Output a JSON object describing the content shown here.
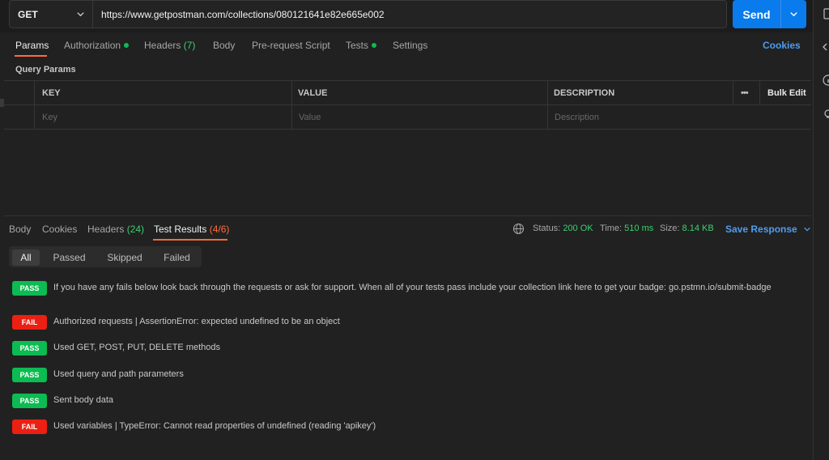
{
  "request": {
    "method": "GET",
    "url": "https://www.getpostman.com/collections/080121641e82e665e002",
    "send_label": "Send"
  },
  "request_tabs": [
    {
      "label": "Params",
      "count": "",
      "dot": false
    },
    {
      "label": "Authorization",
      "count": "",
      "dot": true
    },
    {
      "label": "Headers",
      "count": "(7)",
      "dot": false
    },
    {
      "label": "Body",
      "count": "",
      "dot": false
    },
    {
      "label": "Pre-request Script",
      "count": "",
      "dot": false
    },
    {
      "label": "Tests",
      "count": "",
      "dot": true
    },
    {
      "label": "Settings",
      "count": "",
      "dot": false
    }
  ],
  "cookies_label": "Cookies",
  "query_params": {
    "title": "Query Params",
    "headers": {
      "key": "KEY",
      "value": "VALUE",
      "description": "DESCRIPTION"
    },
    "bulk_edit": "Bulk Edit",
    "more_label": "•••",
    "placeholders": {
      "key": "Key",
      "value": "Value",
      "description": "Description"
    }
  },
  "response_tabs": [
    {
      "label": "Body",
      "count": ""
    },
    {
      "label": "Cookies",
      "count": ""
    },
    {
      "label": "Headers",
      "count": "(24)"
    },
    {
      "label": "Test Results",
      "count": "(4/6)"
    }
  ],
  "response_meta": {
    "status_label": "Status:",
    "status_value": "200 OK",
    "time_label": "Time:",
    "time_value": "510 ms",
    "size_label": "Size:",
    "size_value": "8.14 KB",
    "save_response": "Save Response"
  },
  "filters": [
    "All",
    "Passed",
    "Skipped",
    "Failed"
  ],
  "results": [
    {
      "status": "PASS",
      "text": "If you have any fails below look back through the requests or ask for support. When all of your tests pass include your collection link here to get your badge: go.pstmn.io/submit-badge"
    },
    {
      "status": "FAIL",
      "text": "Authorized requests | AssertionError: expected undefined to be an object"
    },
    {
      "status": "PASS",
      "text": "Used GET, POST, PUT, DELETE methods"
    },
    {
      "status": "PASS",
      "text": "Used query and path parameters"
    },
    {
      "status": "PASS",
      "text": "Sent body data"
    },
    {
      "status": "FAIL",
      "text": "Used variables | TypeError: Cannot read properties of undefined (reading 'apikey')"
    }
  ],
  "colors": {
    "accent": "#ff6c37",
    "send": "#097bed",
    "pass": "#0cbb52",
    "fail": "#eb2013",
    "link": "#4f9cf0"
  },
  "icons": [
    "chevron-down-icon",
    "globe-icon",
    "more-icon",
    "code-icon",
    "info-icon",
    "lightbulb-icon"
  ]
}
